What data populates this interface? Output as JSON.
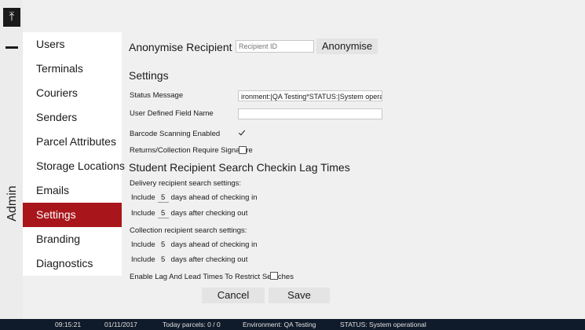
{
  "rail": {
    "up_glyph": "⤒",
    "admin_label": "Admin"
  },
  "sidebar": {
    "items": [
      {
        "label": "Users"
      },
      {
        "label": "Terminals"
      },
      {
        "label": "Couriers"
      },
      {
        "label": "Senders"
      },
      {
        "label": "Parcel Attributes"
      },
      {
        "label": "Storage Locations"
      },
      {
        "label": "Emails"
      },
      {
        "label": "Settings"
      },
      {
        "label": "Branding"
      },
      {
        "label": "Diagnostics"
      }
    ],
    "active_index": 7,
    "active_color": "#a8161b"
  },
  "anonymise": {
    "title": "Anonymise Recipient",
    "placeholder": "Recipient ID",
    "button": "Anonymise"
  },
  "settings": {
    "title": "Settings",
    "status_message_label": "Status Message",
    "status_message_value": "ironment:|QA Testing*STATUS:|System operational",
    "user_field_label": "User Defined Field Name",
    "user_field_value": "",
    "barcode_label": "Barcode Scanning Enabled",
    "barcode_checked": true,
    "returns_label": "Returns/Collection Require Signature",
    "returns_checked": false
  },
  "lag": {
    "title": "Student Recipient Search Checkin Lag Times",
    "delivery_label": "Delivery recipient search settings:",
    "delivery_ahead": {
      "prefix": "Include",
      "value": "5",
      "suffix": "days ahead of checking in"
    },
    "delivery_after": {
      "prefix": "Include",
      "value": "5",
      "suffix": "days after checking out"
    },
    "collection_label": "Collection recipient search settings:",
    "collection_ahead": {
      "prefix": "Include",
      "value": "5",
      "suffix": "days ahead of checking in"
    },
    "collection_after": {
      "prefix": "Include",
      "value": "5",
      "suffix": "days after checking out"
    },
    "enable_label": "Enable Lag And Lead Times To Restrict Searches",
    "enable_checked": false
  },
  "actions": {
    "cancel": "Cancel",
    "save": "Save"
  },
  "statusbar": {
    "time": "09:15:21",
    "date": "01/11/2017",
    "parcels": "Today parcels: 0 / 0",
    "environment": "Environment:  QA Testing",
    "status": "STATUS:  System operational"
  }
}
